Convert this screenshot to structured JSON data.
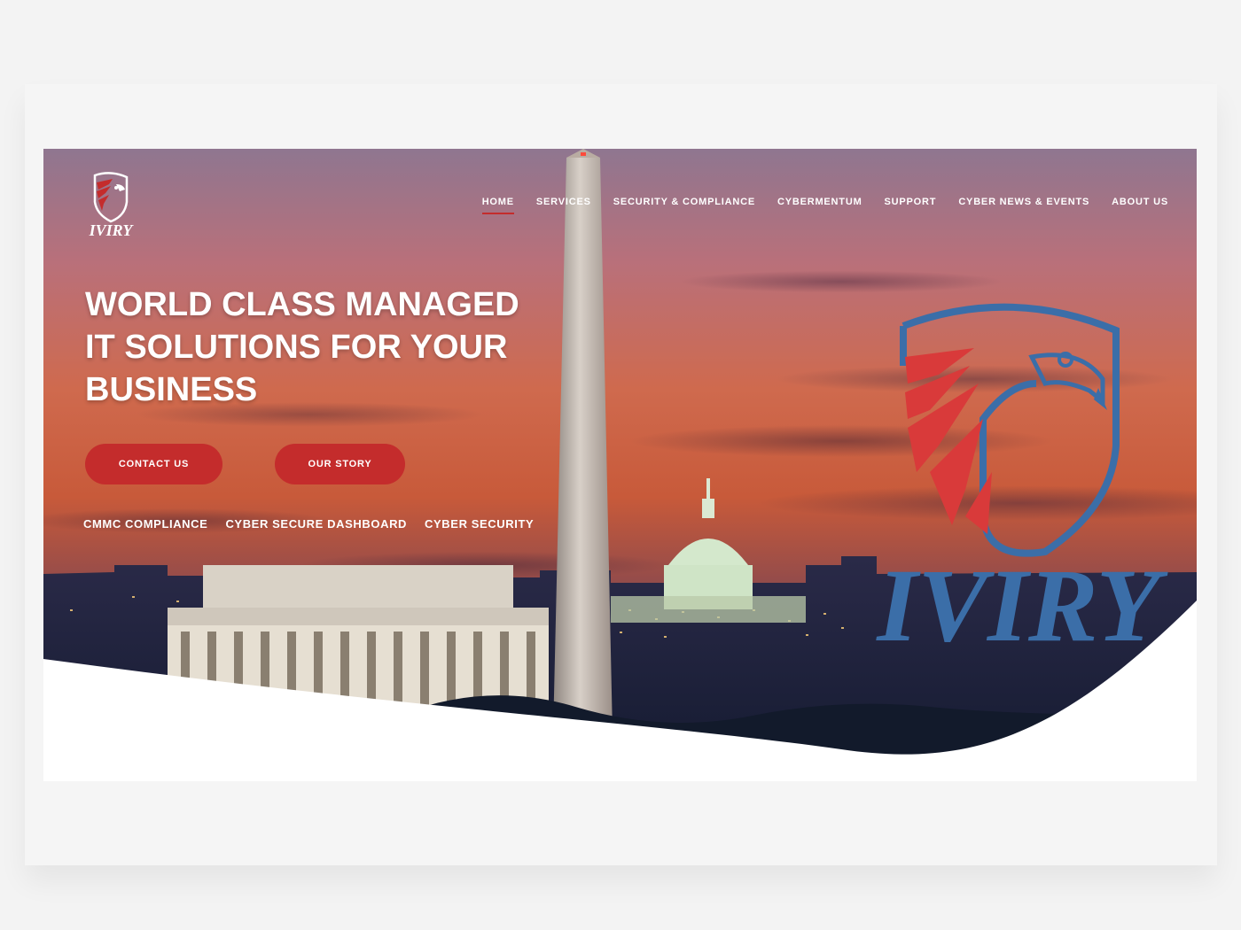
{
  "brand": {
    "name": "IVIRY",
    "colors": {
      "red": "#c42c2c",
      "blue": "#3b6ea8",
      "white": "#ffffff"
    }
  },
  "nav": {
    "items": [
      {
        "label": "HOME",
        "active": true
      },
      {
        "label": "SERVICES",
        "active": false
      },
      {
        "label": "SECURITY & COMPLIANCE",
        "active": false
      },
      {
        "label": "CYBERMENTUM",
        "active": false
      },
      {
        "label": "SUPPORT",
        "active": false
      },
      {
        "label": "CYBER NEWS & EVENTS",
        "active": false
      },
      {
        "label": "ABOUT US",
        "active": false
      }
    ]
  },
  "hero": {
    "headline_lines": [
      "WORLD CLASS MANAGED",
      "IT SOLUTIONS FOR YOUR",
      "BUSINESS"
    ],
    "buttons": {
      "contact": "CONTACT US",
      "story": "OUR STORY"
    },
    "links": [
      "CMMC COMPLIANCE",
      "CYBER SECURE DASHBOARD",
      "CYBER SECURITY"
    ]
  }
}
